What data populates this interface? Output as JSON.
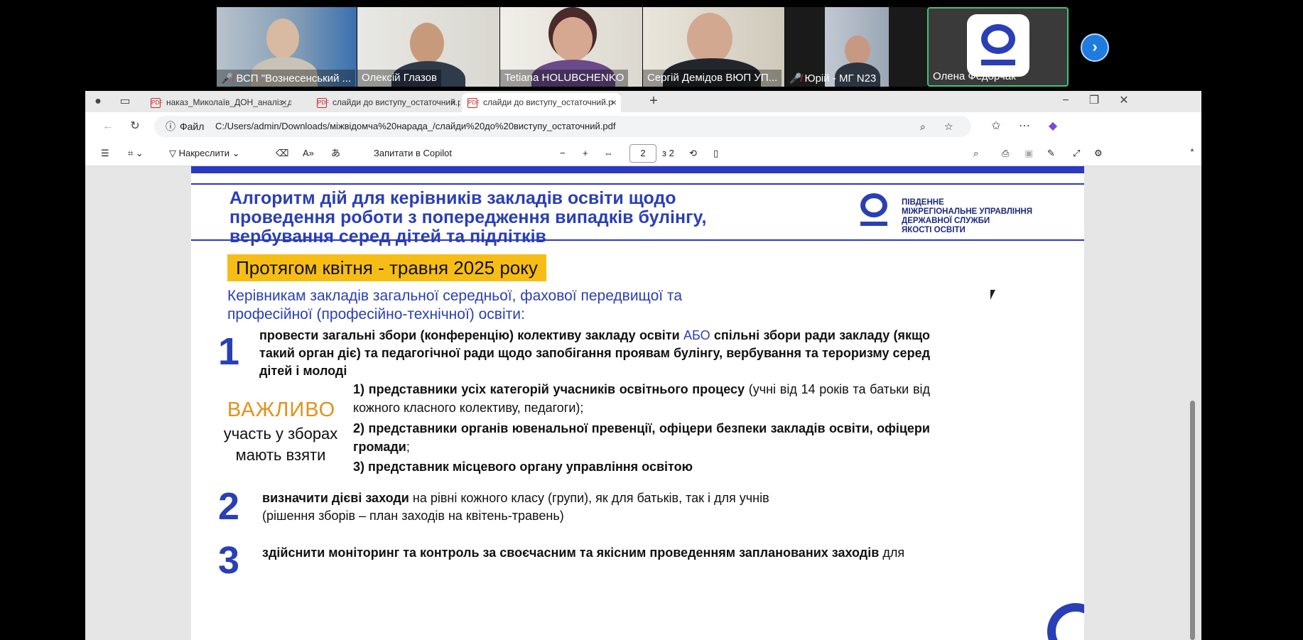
{
  "meeting": {
    "participants": [
      {
        "name": "ВСП \"Вознесенський ...",
        "muted": true
      },
      {
        "name": "Олексій Глазов",
        "muted": false
      },
      {
        "name": "Tetiana HOLUBCHENKO",
        "muted": false
      },
      {
        "name": "Сергій Демідов ВЮП УП...",
        "muted": false
      },
      {
        "name": "Юрій - МГ N23",
        "muted": true
      },
      {
        "name": "Олена Федорчак",
        "muted": false
      }
    ],
    "next_label": "›"
  },
  "browser": {
    "tabs": [
      {
        "title": "наказ_Миколаїв_ДОН_аналіз_д3"
      },
      {
        "title": "слайди до виступу_остаточний.p"
      },
      {
        "title": "слайди до виступу_остаточний.p"
      }
    ],
    "file_label": "Файл",
    "url": "C:/Users/admin/Downloads/міжвідомча%20нарада_/слайди%20до%20виступу_остаточний.pdf"
  },
  "pdf_toolbar": {
    "draw_label": "Накреслити",
    "copilot_label": "Запитати в Copilot",
    "page_current": "2",
    "page_total": "з 2"
  },
  "slide": {
    "title": "Алгоритм дій для керівників закладів освіти щодо проведення роботи з попередження випадків булінгу, вербування серед дітей та підлітків",
    "org_name": "ПІВДЕННЕ\nМІЖРЕГІОНАЛЬНЕ УПРАВЛІННЯ\nДЕРЖАВНОЇ СЛУЖБИ\nЯКОСТІ ОСВІТИ",
    "period": "Протягом квітня - травня 2025 року",
    "audience": "Керівникам закладів загальної середньої, фахової передвищої та професійної (професійно-технічної) освіти:",
    "step1": {
      "num": "1",
      "text_a": "провести загальні збори (конференцію) колективу закладу освіти ",
      "text_or": "АБО",
      "text_b": " спільні збори ради закладу (якщо такий орган діє) та педагогічної ради щодо запобігання проявам булінгу, вербування та тероризму серед дітей і молоді"
    },
    "important_title": "ВАЖЛИВО",
    "important_desc": "участь у зборах мають взяти",
    "participants_list": [
      {
        "bold": "1) представники усіх категорій учасників освітнього процесу",
        "rest": " (учні від 14 років та батьки від кожного класного колективу, педагоги);"
      },
      {
        "bold": "2) представники органів ювенальної превенції, офіцери безпеки закладів освіти, офіцери громади",
        "rest": ";"
      },
      {
        "bold": "3) представник місцевого органу управління освітою",
        "rest": ""
      }
    ],
    "step2": {
      "num": "2",
      "bold": "визначити дієві заходи",
      "rest": " на рівні кожного класу (групи), як для батьків, так і для учнів",
      "line2": "(рішення зборів – план заходів на квітень-травень)"
    },
    "step3": {
      "num": "3",
      "bold": "здійснити моніторинг та контроль за своєчасним та якісним проведенням запланованих заходів",
      "rest": " для"
    }
  }
}
